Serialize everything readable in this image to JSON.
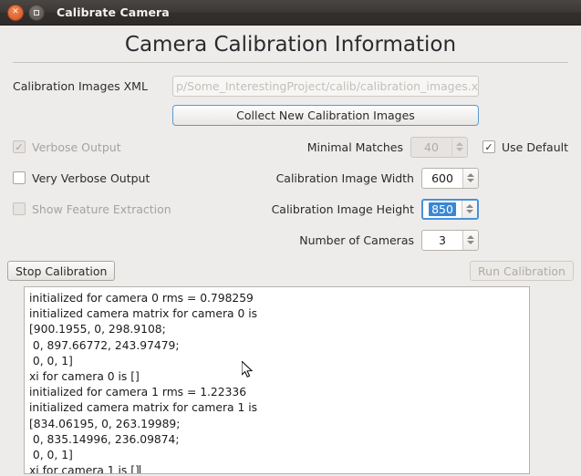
{
  "window": {
    "title": "Calibrate Camera",
    "close_icon": "close-icon",
    "maximize_icon": "maximize-icon"
  },
  "header": {
    "title": "Camera Calibration Information"
  },
  "form": {
    "xml": {
      "label": "Calibration Images XML",
      "value": "",
      "placeholder": "p/Some_InterestingProject/calib/calibration_images.xml"
    },
    "collect_button": "Collect New Calibration Images",
    "checkboxes": [
      {
        "label": "Verbose Output",
        "checked": true,
        "enabled": false,
        "mark": "✓"
      },
      {
        "label": "Very Verbose Output",
        "checked": false,
        "enabled": true,
        "mark": ""
      },
      {
        "label": "Show Feature Extraction",
        "checked": false,
        "enabled": false,
        "mark": ""
      }
    ],
    "use_default": {
      "label": "Use Default",
      "checked": true,
      "enabled": true,
      "mark": "✓"
    },
    "fields": [
      {
        "label": "Minimal Matches",
        "value": "40",
        "enabled": false,
        "focused": false
      },
      {
        "label": "Calibration Image Width",
        "value": "600",
        "enabled": true,
        "focused": false
      },
      {
        "label": "Calibration Image Height",
        "value": "850",
        "enabled": true,
        "focused": true
      },
      {
        "label": "Number of Cameras",
        "value": "3",
        "enabled": true,
        "focused": false
      }
    ]
  },
  "actions": {
    "stop_label": "Stop Calibration",
    "run_label": "Run Calibration"
  },
  "log": {
    "lines": [
      "initialized for camera 0 rms = 0.798259",
      "initialized camera matrix for camera 0 is",
      "[900.1955, 0, 298.9108;",
      " 0, 897.66772, 243.97479;",
      " 0, 0, 1]",
      "xi for camera 0 is []",
      "initialized for camera 1 rms = 1.22336",
      "initialized camera matrix for camera 1 is",
      "[834.06195, 0, 263.19989;",
      " 0, 835.14996, 236.09874;",
      " 0, 0, 1]",
      "xi for camera 1 is []"
    ]
  },
  "colors": {
    "accent_focus": "#4a90d9",
    "selection": "#3a87d4",
    "window_bg": "#edeceb",
    "titlebar": "#3c3835",
    "close_button": "#e4703c"
  }
}
